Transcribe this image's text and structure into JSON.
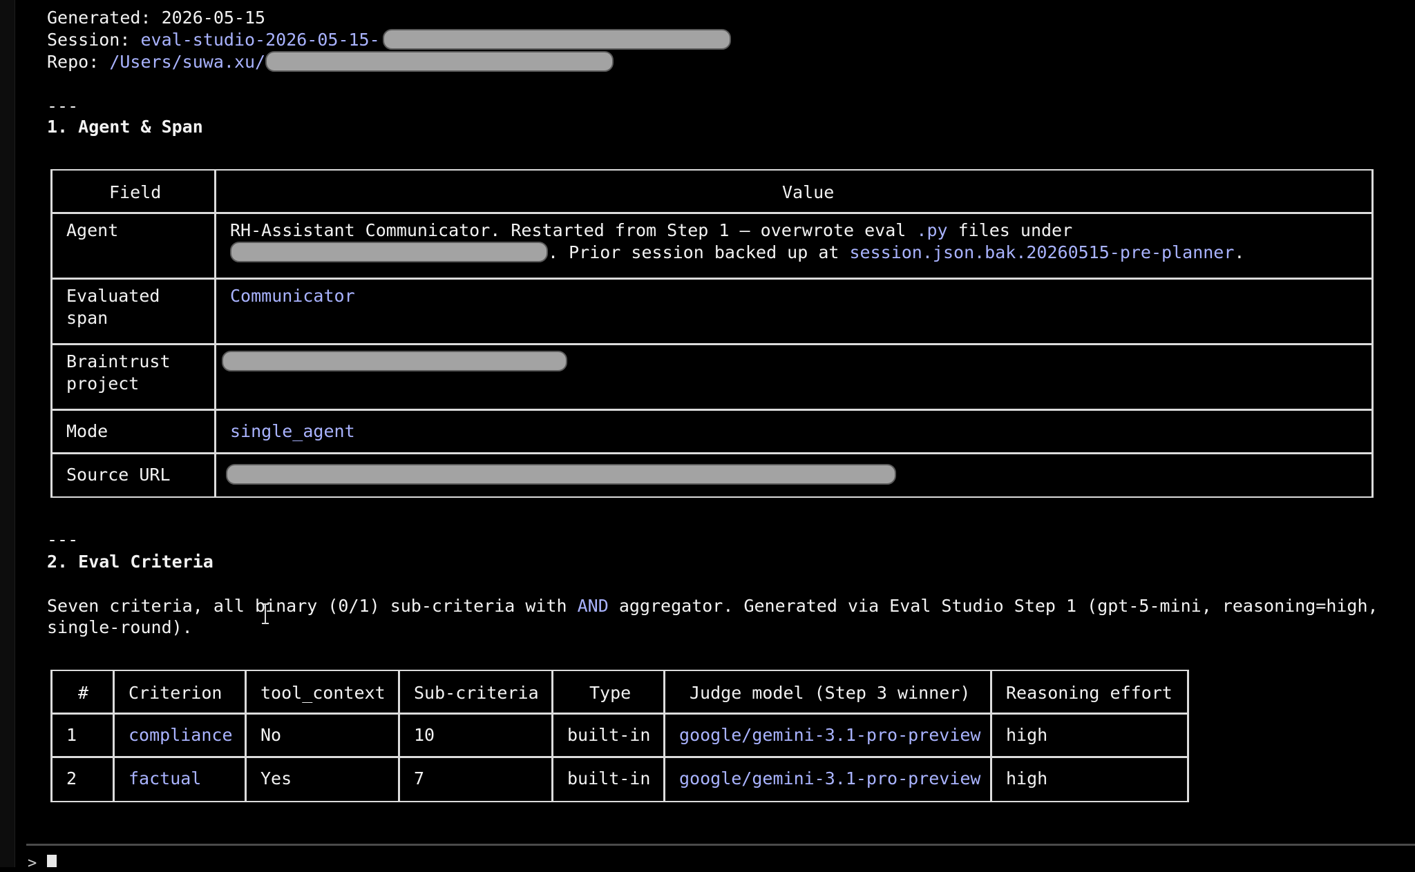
{
  "header": {
    "generated_label": "Generated:",
    "generated_value": "2026-05-15",
    "session_label": "Session:",
    "session_value": "eval-studio-2026-05-15-",
    "repo_label": "Repo:",
    "repo_value": "/Users/suwa.xu/"
  },
  "section1": {
    "rule": "---",
    "title": "1. Agent & Span",
    "columns": [
      "Field",
      "Value"
    ],
    "rows": {
      "agent": {
        "field": "Agent",
        "line1_a": "RH-Assistant Communicator. Restarted from Step 1 – overwrote eval ",
        "line1_b": ".py",
        "line1_c": " files under",
        "line2_a": ". Prior session backed up at ",
        "line2_b": "session.json.bak.20260515-pre-planner",
        "line2_c": "."
      },
      "span": {
        "field_line1": "Evaluated",
        "field_line2": "span",
        "value": "Communicator"
      },
      "project": {
        "field_line1": "Braintrust",
        "field_line2": "project"
      },
      "mode": {
        "field": "Mode",
        "value": "single_agent"
      },
      "source": {
        "field": "Source URL"
      }
    }
  },
  "section2": {
    "rule": "---",
    "title": "2. Eval Criteria",
    "desc_a": "Seven criteria, all binary (0/1) sub-criteria with ",
    "desc_b": "AND",
    "desc_c": " aggregator. Generated via Eval Studio Step 1 (gpt-5-mini, reasoning=high,",
    "desc_d": "single-round).",
    "columns": [
      "#",
      "Criterion",
      "tool_context",
      "Sub-criteria",
      "Type",
      "Judge model (Step 3 winner)",
      "Reasoning effort"
    ],
    "rows": [
      {
        "num": "1",
        "criterion": "compliance",
        "tool_context": "No",
        "sub": "10",
        "type": "built-in",
        "judge": "google/gemini-3.1-pro-preview",
        "effort": "high"
      },
      {
        "num": "2",
        "criterion": "factual",
        "tool_context": "Yes",
        "sub": "7",
        "type": "built-in",
        "judge": "google/gemini-3.1-pro-preview",
        "effort": "high"
      }
    ]
  },
  "prompt": {
    "caret": ">"
  },
  "colors": {
    "background": "#000000",
    "text": "#f2f2f2",
    "accent": "#a9b3ff",
    "redaction": "#a3a3a3"
  },
  "icons": [
    "text-cursor-icon",
    "terminal-cursor-icon"
  ]
}
